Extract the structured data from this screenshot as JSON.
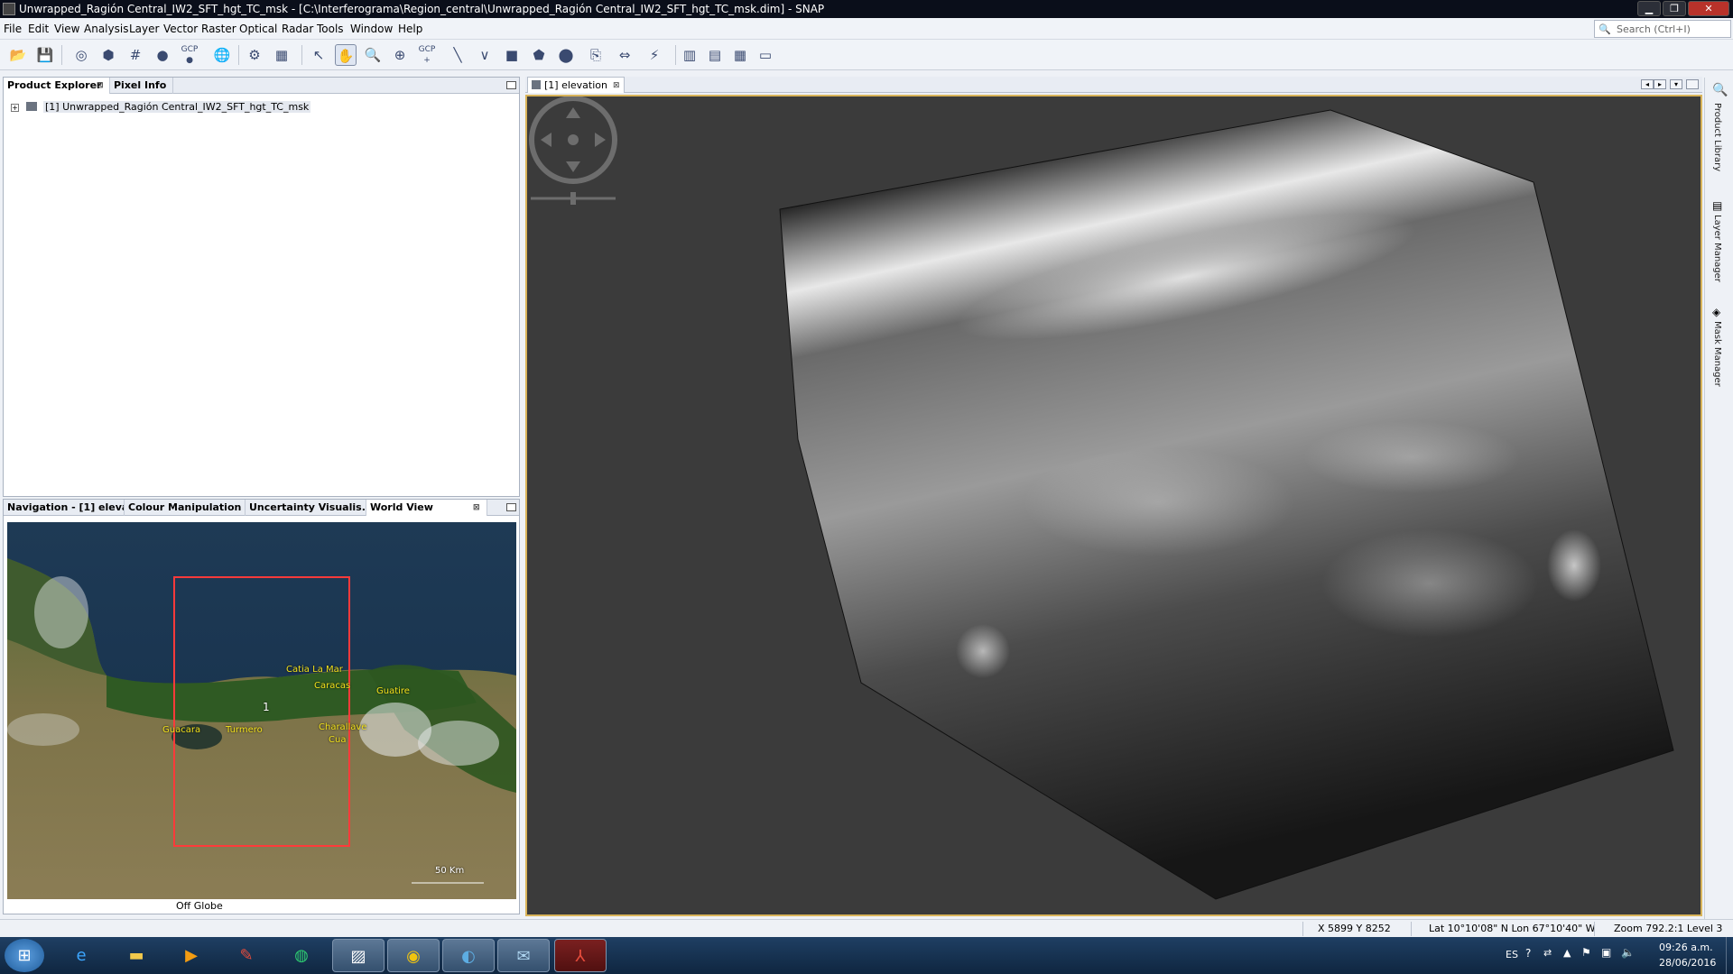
{
  "window": {
    "title": "Unwrapped_Ragión Central_IW2_SFT_hgt_TC_msk - [C:\\Interferograma\\Region_central\\Unwrapped_Ragión Central_IW2_SFT_hgt_TC_msk.dim] - SNAP",
    "minimize": "▁",
    "maximize": "❐",
    "close": "✕"
  },
  "menu": [
    "File",
    "Edit",
    "View",
    "Analysis",
    "Layer",
    "Vector",
    "Raster",
    "Optical",
    "Radar",
    "Tools",
    "Window",
    "Help"
  ],
  "search": {
    "placeholder": "Search (Ctrl+I)"
  },
  "toolbar": {
    "items": [
      "open-product",
      "save-product",
      "session",
      "import",
      "graticule",
      "pin",
      "gcp",
      "world-wind",
      "graph-builder",
      "batch",
      "select-tool",
      "pan-tool",
      "zoom-tool",
      "zoom-add",
      "gcp-tool",
      "line-tool",
      "polyline-tool",
      "rectangle-tool",
      "polygon-tool",
      "ellipse-tool",
      "insert-tool",
      "range-finder",
      "magic-wand",
      "tile-1",
      "tile-2",
      "tile-3",
      "tile-4"
    ],
    "gcp_label": "GCP"
  },
  "product_explorer": {
    "tabs": [
      {
        "label": "Product Explorer",
        "active": true
      },
      {
        "label": "Pixel Info",
        "active": false
      }
    ],
    "tree_item": "[1] Unwrapped_Ragión Central_IW2_SFT_hgt_TC_msk"
  },
  "bottom_panel": {
    "tabs": [
      {
        "label": "Navigation - [1] eleva..."
      },
      {
        "label": "Colour Manipulation ..."
      },
      {
        "label": "Uncertainty Visualis..."
      },
      {
        "label": "World View"
      }
    ],
    "map": {
      "cities": [
        "Catia La Mar",
        "Caracas",
        "Guatire",
        "Guacara",
        "Turmero",
        "Charallave",
        "Cua"
      ],
      "footprint_label": "1",
      "scale": "50 Km",
      "footer": "Off Globe"
    }
  },
  "image_view": {
    "tab_label": "[1] elevation"
  },
  "right_sidebar": [
    "Product Library",
    "Layer Manager",
    "Mask Manager"
  ],
  "status": {
    "pixel": "X   5899  Y    8252",
    "latlon": "Lat 10°10'08\" N  Lon 67°10'40\" W",
    "zoom": "Zoom 792.2:1  Level 3"
  },
  "taskbar": {
    "apps": [
      "start",
      "internet-explorer",
      "file-explorer",
      "media-player",
      "app-red",
      "world-wind",
      "snap",
      "chrome",
      "google-earth",
      "thunderbird",
      "acrobat"
    ],
    "lang": "ES",
    "time": "09:26 a.m.",
    "date": "28/06/2016"
  }
}
